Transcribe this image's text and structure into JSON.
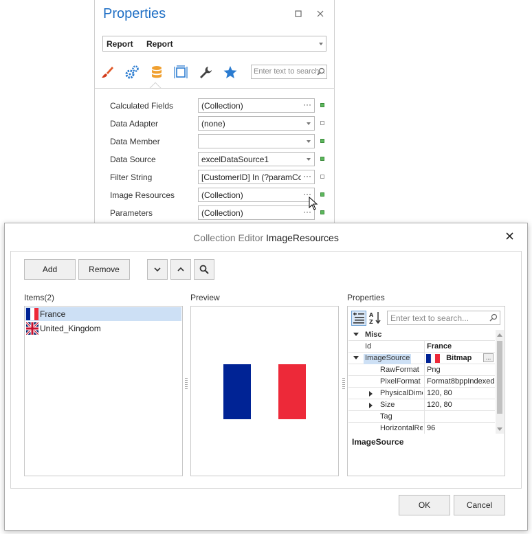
{
  "properties_panel": {
    "title": "Properties",
    "object_selector": {
      "type": "Report",
      "name": "Report"
    },
    "tabs": [
      {
        "name": "appearance",
        "icon": "brush-icon"
      },
      {
        "name": "behavior",
        "icon": "gears-icon"
      },
      {
        "name": "data",
        "icon": "database-icon",
        "active": true
      },
      {
        "name": "layout",
        "icon": "layout-icon"
      },
      {
        "name": "tasks",
        "icon": "wrench-icon"
      },
      {
        "name": "favorites",
        "icon": "star-icon"
      }
    ],
    "search_placeholder": "Enter text to search...",
    "rows": [
      {
        "label": "Calculated Fields",
        "value": "(Collection)",
        "editor": "ellipsis",
        "marker": "set"
      },
      {
        "label": "Data Adapter",
        "value": "(none)",
        "editor": "dropdown",
        "marker": "unset"
      },
      {
        "label": "Data Member",
        "value": "",
        "editor": "dropdown",
        "marker": "set"
      },
      {
        "label": "Data Source",
        "value": "excelDataSource1",
        "editor": "dropdown",
        "marker": "set"
      },
      {
        "label": "Filter String",
        "value": "[CustomerID] In (?paramCo...",
        "editor": "ellipsis",
        "marker": "unset"
      },
      {
        "label": "Image Resources",
        "value": "(Collection)",
        "editor": "ellipsis",
        "marker": "set"
      },
      {
        "label": "Parameters",
        "value": "(Collection)",
        "editor": "ellipsis",
        "marker": "set"
      }
    ]
  },
  "collection_editor": {
    "title_prefix": "Collection Editor",
    "title_name": "ImageResources",
    "add_label": "Add",
    "remove_label": "Remove",
    "items_label": "Items(2)",
    "items": [
      {
        "name": "France",
        "flag": "france",
        "selected": true
      },
      {
        "name": "United_Kingdom",
        "flag": "uk",
        "selected": false
      }
    ],
    "preview_label": "Preview",
    "properties_label": "Properties",
    "property_grid": {
      "search_placeholder": "Enter text to search...",
      "category": "Misc",
      "rows": [
        {
          "name": "Id",
          "value": "France"
        },
        {
          "name": "ImageSource",
          "value": "Bitmap"
        },
        {
          "name": "RawFormat",
          "value": "Png"
        },
        {
          "name": "PixelFormat",
          "value": "Format8bppIndexed"
        },
        {
          "name": "PhysicalDime",
          "value": "120, 80"
        },
        {
          "name": "Size",
          "value": "120, 80"
        },
        {
          "name": "Tag",
          "value": ""
        },
        {
          "name": "HorizontalRe",
          "value": "96"
        }
      ],
      "description": "ImageSource"
    },
    "ok_label": "OK",
    "cancel_label": "Cancel"
  },
  "colors": {
    "accent": "#1f6fc5",
    "france_blue": "#002395",
    "france_red": "#ED2939",
    "selection": "#cde0f5"
  }
}
